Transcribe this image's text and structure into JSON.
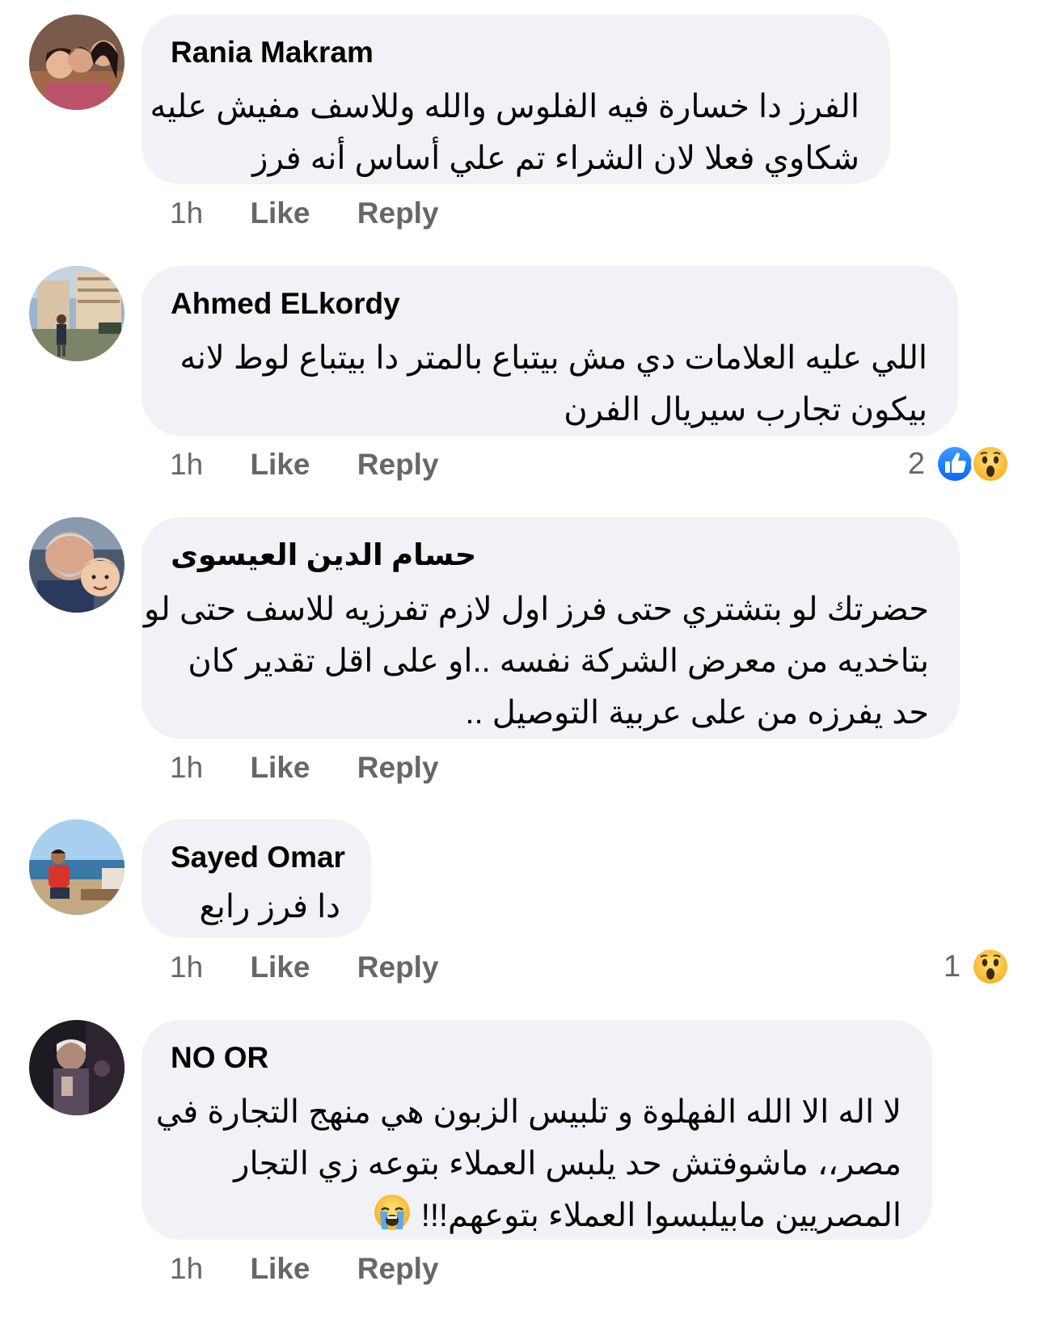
{
  "comments": [
    {
      "author": "Rania Makram",
      "lines": [
        "الفرز دا خسارة فيه الفلوس والله وللاسف مفيش عليه",
        "شكاوي فعلا لان الشراء تم علي أساس أنه فرز"
      ],
      "time": "1h",
      "like_label": "Like",
      "reply_label": "Reply"
    },
    {
      "author": "Ahmed ELkordy",
      "lines": [
        "اللي عليه العلامات دي مش بيتباع بالمتر دا بيتباع لوط لانه",
        "بيكون تجارب سيريال الفرن"
      ],
      "time": "1h",
      "like_label": "Like",
      "reply_label": "Reply",
      "reaction_count": "2",
      "reaction_icons": [
        "like-icon",
        "wow-emoji-icon"
      ]
    },
    {
      "author": "حسام الدين العيسوى",
      "lines": [
        "حضرتك لو بتشتري حتى فرز اول لازم تفرزيه للاسف حتى لو",
        "بتاخديه من معرض الشركة نفسه ..او على اقل تقدير كان",
        "حد يفرزه من على عربية التوصيل .."
      ],
      "time": "1h",
      "like_label": "Like",
      "reply_label": "Reply"
    },
    {
      "author": "Sayed Omar",
      "lines": [
        "دا فرز رابع"
      ],
      "time": "1h",
      "like_label": "Like",
      "reply_label": "Reply",
      "reaction_count": "1",
      "reaction_icons": [
        "wow-emoji-icon"
      ]
    },
    {
      "author": "NO OR",
      "lines": [
        "لا اله الا الله الفهلوة و تلبيس الزبون هي منهج التجارة في",
        "مصر،، ماشوفتش حد يلبس العملاء بتوعه زي التجار",
        "المصريين مابيلبسوا العملاء بتوعهم!!!"
      ],
      "line_emoji": "crying-face-emoji",
      "time": "1h",
      "like_label": "Like",
      "reply_label": "Reply"
    }
  ],
  "colors": {
    "bubble": "#f0f2f5",
    "secondary_text": "#65676b",
    "like_blue": "#1877f2"
  }
}
